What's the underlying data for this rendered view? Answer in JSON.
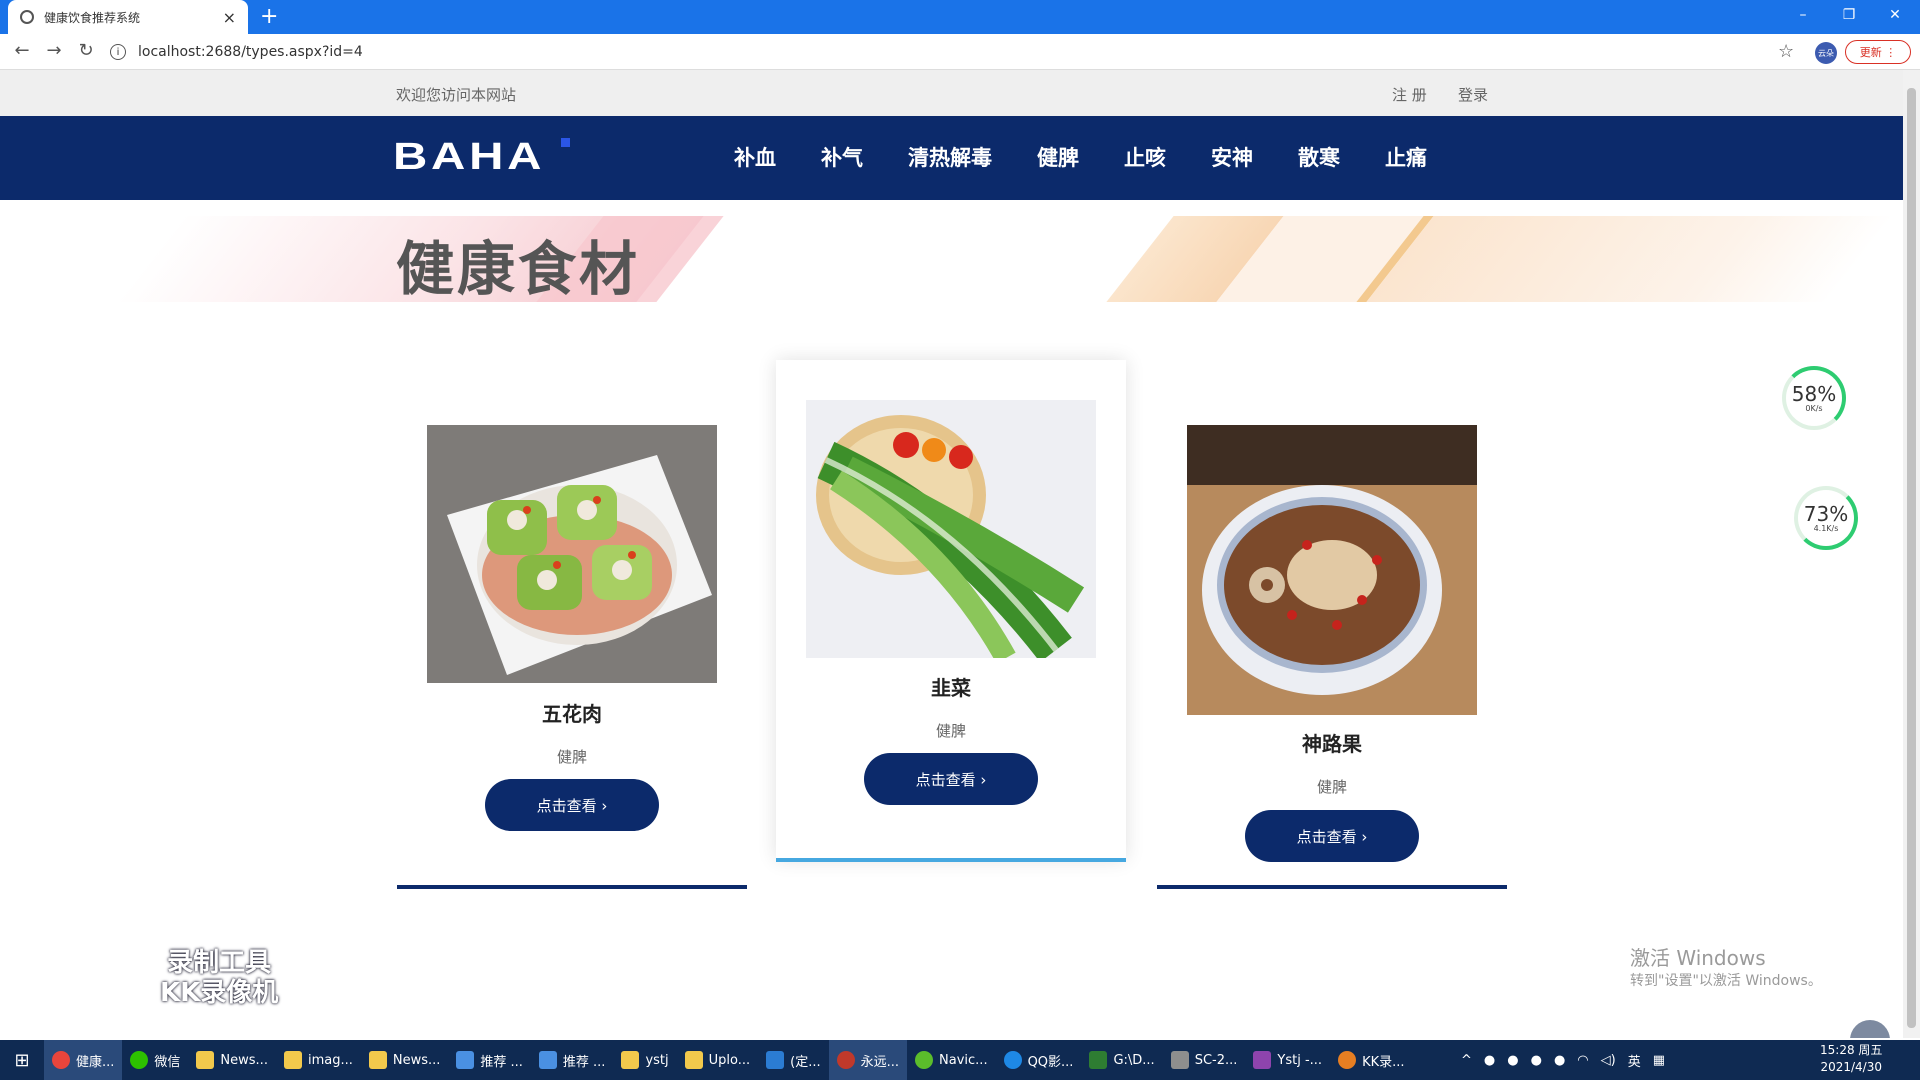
{
  "browser": {
    "tab_title": "健康饮食推荐系统",
    "url": "localhost:2688/types.aspx?id=4",
    "update_label": "更新",
    "profile_label": "云朵"
  },
  "site": {
    "welcome": "欢迎您访问本网站",
    "register": "注 册",
    "login": "登录",
    "logo": "BAHA",
    "nav": [
      "补血",
      "补气",
      "清热解毒",
      "健脾",
      "止咳",
      "安神",
      "散寒",
      "止痛"
    ],
    "banner_title": "健康食材",
    "items": [
      {
        "name": "五花肉",
        "category": "健脾",
        "button": "点击查看 ›"
      },
      {
        "name": "韭菜",
        "category": "健脾",
        "button": "点击查看 ›"
      },
      {
        "name": "神路果",
        "category": "健脾",
        "button": "点击查看 ›"
      }
    ],
    "brand_colors": {
      "primary": "#0c2a6b",
      "active_underline": "#46a8e0"
    }
  },
  "overlays": {
    "gauge1": {
      "pct": "58%",
      "speed": "0K/s"
    },
    "gauge2": {
      "pct": "73%",
      "speed": "4.1K/s"
    },
    "recorder": "录制工具\nKK录像机",
    "activate_title": "激活 Windows",
    "activate_sub": "转到\"设置\"以激活 Windows。"
  },
  "taskbar": {
    "items": [
      "健康...",
      "微信",
      "News...",
      "imag...",
      "News...",
      "推荐 ...",
      "推荐 ...",
      "ystj",
      "Uplo...",
      "(定...",
      "永远...",
      "Navic...",
      "QQ影...",
      "G:\\D...",
      "SC-2...",
      "Ystj -...",
      "KK录..."
    ],
    "time": "15:28 周五",
    "date": "2021/4/30",
    "ime": "英"
  }
}
